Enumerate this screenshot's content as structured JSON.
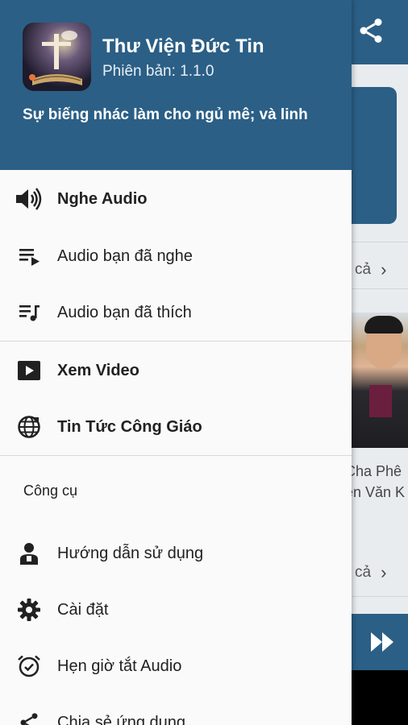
{
  "header": {
    "app_title": "Thư Viện Đức Tin",
    "version": "Phiên bản: 1.1.0",
    "quote": "Sự biếng nhác làm cho ngủ mê; và linh"
  },
  "menu": {
    "listen_audio": "Nghe Audio",
    "heard_audio": "Audio bạn đã nghe",
    "liked_audio": "Audio bạn đã thích",
    "watch_video": "Xem Video",
    "catholic_news": "Tin Tức Công Giáo",
    "tools_section": "Công cụ",
    "user_guide": "Hướng dẫn sử dụng",
    "settings": "Cài đặt",
    "sleep_timer": "Hẹn giờ tắt Audio",
    "share_app": "Chia sẻ ứng dụng"
  },
  "background": {
    "see_all_1": "cả",
    "see_all_2": "cả",
    "caption_line1": "Cha Phê",
    "caption_line2": "ễn Văn K"
  },
  "colors": {
    "primary": "#2b5f86",
    "drawer_bg": "#fafafa",
    "text": "#212121"
  }
}
